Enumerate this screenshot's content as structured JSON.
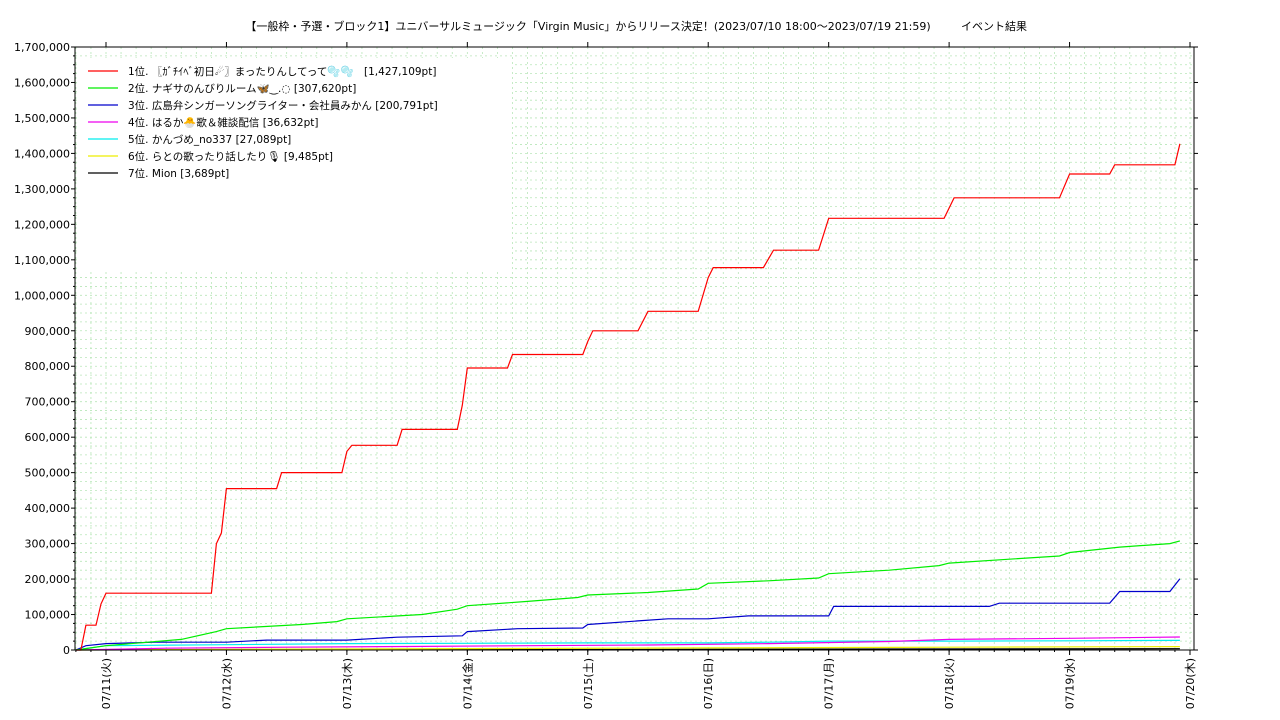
{
  "title": "【一般枠・予選・ブロック1】ユニバーサルミュージック「Virgin Music」からリリース決定！(2023/07/10 18:00～2023/07/19 21:59)",
  "subtitle": "イベント結果",
  "chart_data": {
    "type": "line",
    "x_range": [
      "2023-07-10 18:00",
      "2023-07-19 21:59"
    ],
    "ylim": [
      0,
      1700000
    ],
    "y_ticks": [
      "0",
      "100,000",
      "200,000",
      "300,000",
      "400,000",
      "500,000",
      "600,000",
      "700,000",
      "800,000",
      "900,000",
      "1,000,000",
      "1,100,000",
      "1,200,000",
      "1,300,000",
      "1,400,000",
      "1,500,000",
      "1,600,000",
      "1,700,000"
    ],
    "x_ticks": [
      {
        "label": "07/11(火)",
        "date": "2023-07-11 00:00"
      },
      {
        "label": "07/12(水)",
        "date": "2023-07-12 00:00"
      },
      {
        "label": "07/13(木)",
        "date": "2023-07-13 00:00"
      },
      {
        "label": "07/14(金)",
        "date": "2023-07-14 00:00"
      },
      {
        "label": "07/15(土)",
        "date": "2023-07-15 00:00"
      },
      {
        "label": "07/16(日)",
        "date": "2023-07-16 00:00"
      },
      {
        "label": "07/17(月)",
        "date": "2023-07-17 00:00"
      },
      {
        "label": "07/18(火)",
        "date": "2023-07-18 00:00"
      },
      {
        "label": "07/19(水)",
        "date": "2023-07-19 00:00"
      },
      {
        "label": "07/20(木)",
        "date": "2023-07-20 00:00"
      }
    ],
    "grid": true,
    "legend_position": "top-left",
    "series": [
      {
        "name": "1位. 〖ｶﾞﾁｲﾍﾞ初日☄〗まったりんしてって🫧🫧　[1,427,109pt]",
        "color": "#ff0000",
        "points": [
          [
            "2023-07-10 18:00",
            0
          ],
          [
            "2023-07-10 19:00",
            0
          ],
          [
            "2023-07-10 20:00",
            70000
          ],
          [
            "2023-07-10 22:00",
            70000
          ],
          [
            "2023-07-10 23:00",
            130000
          ],
          [
            "2023-07-11 00:00",
            160000
          ],
          [
            "2023-07-11 21:00",
            160000
          ],
          [
            "2023-07-11 22:00",
            300000
          ],
          [
            "2023-07-11 23:00",
            330000
          ],
          [
            "2023-07-12 00:00",
            455000
          ],
          [
            "2023-07-12 10:00",
            455000
          ],
          [
            "2023-07-12 11:00",
            500000
          ],
          [
            "2023-07-12 23:00",
            500000
          ],
          [
            "2023-07-13 00:00",
            560000
          ],
          [
            "2023-07-13 01:00",
            577000
          ],
          [
            "2023-07-13 10:00",
            577000
          ],
          [
            "2023-07-13 11:00",
            622000
          ],
          [
            "2023-07-13 22:00",
            622000
          ],
          [
            "2023-07-13 23:00",
            690000
          ],
          [
            "2023-07-14 00:00",
            795000
          ],
          [
            "2023-07-14 08:00",
            795000
          ],
          [
            "2023-07-14 09:00",
            833000
          ],
          [
            "2023-07-14 23:00",
            833000
          ],
          [
            "2023-07-15 00:00",
            870000
          ],
          [
            "2023-07-15 01:00",
            900000
          ],
          [
            "2023-07-15 10:00",
            900000
          ],
          [
            "2023-07-15 12:00",
            955000
          ],
          [
            "2023-07-15 22:00",
            955000
          ],
          [
            "2023-07-16 00:00",
            1050000
          ],
          [
            "2023-07-16 01:00",
            1078000
          ],
          [
            "2023-07-16 11:00",
            1078000
          ],
          [
            "2023-07-16 13:00",
            1127000
          ],
          [
            "2023-07-16 22:00",
            1127000
          ],
          [
            "2023-07-17 00:00",
            1217000
          ],
          [
            "2023-07-17 23:00",
            1217000
          ],
          [
            "2023-07-18 01:00",
            1275000
          ],
          [
            "2023-07-18 22:00",
            1275000
          ],
          [
            "2023-07-19 00:00",
            1342000
          ],
          [
            "2023-07-19 08:00",
            1342000
          ],
          [
            "2023-07-19 09:00",
            1368000
          ],
          [
            "2023-07-19 21:00",
            1368000
          ],
          [
            "2023-07-19 21:59",
            1427109
          ]
        ]
      },
      {
        "name": "2位. ナギサのんびりルーム🦋‿.◌ [307,620pt]",
        "color": "#00ee00",
        "points": [
          [
            "2023-07-10 18:00",
            0
          ],
          [
            "2023-07-11 00:00",
            12000
          ],
          [
            "2023-07-11 15:00",
            30000
          ],
          [
            "2023-07-11 22:00",
            52000
          ],
          [
            "2023-07-12 00:00",
            60000
          ],
          [
            "2023-07-12 15:00",
            72000
          ],
          [
            "2023-07-12 22:00",
            80000
          ],
          [
            "2023-07-13 00:00",
            88000
          ],
          [
            "2023-07-13 15:00",
            100000
          ],
          [
            "2023-07-13 22:00",
            115000
          ],
          [
            "2023-07-14 00:00",
            125000
          ],
          [
            "2023-07-14 12:00",
            137000
          ],
          [
            "2023-07-14 22:00",
            148000
          ],
          [
            "2023-07-15 00:00",
            155000
          ],
          [
            "2023-07-15 12:00",
            162000
          ],
          [
            "2023-07-15 22:00",
            172000
          ],
          [
            "2023-07-16 00:00",
            188000
          ],
          [
            "2023-07-16 12:00",
            195000
          ],
          [
            "2023-07-16 22:00",
            203000
          ],
          [
            "2023-07-17 00:00",
            215000
          ],
          [
            "2023-07-17 12:00",
            225000
          ],
          [
            "2023-07-17 22:00",
            238000
          ],
          [
            "2023-07-18 00:00",
            245000
          ],
          [
            "2023-07-18 12:00",
            256000
          ],
          [
            "2023-07-18 22:00",
            265000
          ],
          [
            "2023-07-19 00:00",
            275000
          ],
          [
            "2023-07-19 10:00",
            290000
          ],
          [
            "2023-07-19 20:00",
            300000
          ],
          [
            "2023-07-19 21:59",
            307620
          ]
        ]
      },
      {
        "name": "3位. 広島弁シンガーソングライター・会社員みかん [200,791pt]",
        "color": "#0000cc",
        "points": [
          [
            "2023-07-10 18:00",
            0
          ],
          [
            "2023-07-10 20:00",
            12000
          ],
          [
            "2023-07-11 00:00",
            18000
          ],
          [
            "2023-07-11 10:00",
            22000
          ],
          [
            "2023-07-12 00:00",
            22000
          ],
          [
            "2023-07-12 08:00",
            28000
          ],
          [
            "2023-07-13 00:00",
            28000
          ],
          [
            "2023-07-13 10:00",
            36000
          ],
          [
            "2023-07-13 23:00",
            40000
          ],
          [
            "2023-07-14 00:00",
            52000
          ],
          [
            "2023-07-14 10:00",
            60000
          ],
          [
            "2023-07-14 23:00",
            62000
          ],
          [
            "2023-07-15 00:00",
            72000
          ],
          [
            "2023-07-15 10:00",
            82000
          ],
          [
            "2023-07-15 16:00",
            88000
          ],
          [
            "2023-07-16 00:00",
            88000
          ],
          [
            "2023-07-16 08:00",
            96000
          ],
          [
            "2023-07-17 00:00",
            96000
          ],
          [
            "2023-07-17 01:00",
            123000
          ],
          [
            "2023-07-18 08:00",
            123000
          ],
          [
            "2023-07-18 10:00",
            132000
          ],
          [
            "2023-07-19 08:00",
            132000
          ],
          [
            "2023-07-19 10:00",
            165000
          ],
          [
            "2023-07-19 20:00",
            165000
          ],
          [
            "2023-07-19 21:59",
            200791
          ]
        ]
      },
      {
        "name": "4位. はるか🐣歌＆雑談配信 [36,632pt]",
        "color": "#ee00ee",
        "points": [
          [
            "2023-07-10 18:00",
            0
          ],
          [
            "2023-07-11 12:00",
            5000
          ],
          [
            "2023-07-12 12:00",
            8000
          ],
          [
            "2023-07-13 12:00",
            10000
          ],
          [
            "2023-07-14 12:00",
            12000
          ],
          [
            "2023-07-15 12:00",
            14000
          ],
          [
            "2023-07-16 12:00",
            18000
          ],
          [
            "2023-07-17 12:00",
            24000
          ],
          [
            "2023-07-18 00:00",
            30000
          ],
          [
            "2023-07-19 00:00",
            33000
          ],
          [
            "2023-07-19 21:59",
            36632
          ]
        ]
      },
      {
        "name": "5位. かんづめ_no337 [27,089pt]",
        "color": "#00eeee",
        "points": [
          [
            "2023-07-10 18:00",
            0
          ],
          [
            "2023-07-11 00:00",
            12000
          ],
          [
            "2023-07-12 00:00",
            15000
          ],
          [
            "2023-07-13 00:00",
            18000
          ],
          [
            "2023-07-14 00:00",
            19000
          ],
          [
            "2023-07-15 00:00",
            20000
          ],
          [
            "2023-07-16 00:00",
            20000
          ],
          [
            "2023-07-16 12:00",
            22000
          ],
          [
            "2023-07-17 00:00",
            25000
          ],
          [
            "2023-07-18 00:00",
            25000
          ],
          [
            "2023-07-19 00:00",
            26000
          ],
          [
            "2023-07-19 21:59",
            27089
          ]
        ]
      },
      {
        "name": "6位. らとの歌ったり話したり🎙 [9,485pt]",
        "color": "#eeee00",
        "points": [
          [
            "2023-07-10 18:00",
            0
          ],
          [
            "2023-07-12 00:00",
            2000
          ],
          [
            "2023-07-14 00:00",
            4000
          ],
          [
            "2023-07-16 00:00",
            6000
          ],
          [
            "2023-07-18 00:00",
            8000
          ],
          [
            "2023-07-19 21:59",
            9485
          ]
        ]
      },
      {
        "name": "7位. Mion [3,689pt]",
        "color": "#000000",
        "points": [
          [
            "2023-07-10 18:00",
            0
          ],
          [
            "2023-07-13 00:00",
            500
          ],
          [
            "2023-07-15 00:00",
            1500
          ],
          [
            "2023-07-17 00:00",
            2500
          ],
          [
            "2023-07-19 21:59",
            3689
          ]
        ]
      }
    ]
  }
}
